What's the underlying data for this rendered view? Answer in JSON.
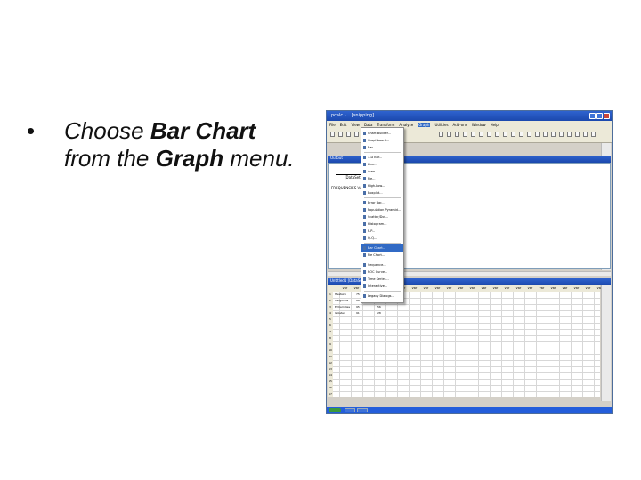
{
  "slide": {
    "bullet": "•",
    "line1_pre": "Choose ",
    "line1_bold": "Bar Chart",
    "line2_pre": "from the ",
    "line2_bold": "Graph",
    "line2_post": " menu."
  },
  "window": {
    "title": "pcalc - .. [snipping]",
    "menubar": [
      "File",
      "Edit",
      "View",
      "Data",
      "Transform",
      "Analyze",
      "Graph",
      "Utilities",
      "Add-ons",
      "Window",
      "Help"
    ],
    "active_menu": "Graph",
    "output_pane_title": "Output",
    "output_heading": "[DataSet1]",
    "output_text": "FREQUENCIES VARIABLES=pv",
    "data_pane_title": "Untitled1 [DataSet0] - SPSS Data Editor",
    "grid_columns": [
      "",
      "var",
      "var",
      "var",
      "var",
      "var",
      "var",
      "var",
      "var",
      "var",
      "var",
      "var",
      "var",
      "var",
      "var",
      "var",
      "var",
      "var",
      "var",
      "var",
      "var",
      "var",
      "var",
      "var"
    ],
    "grid_cells": [
      [
        "Heatsink",
        "75",
        "41"
      ],
      [
        "Invigorate",
        "86",
        "49"
      ],
      [
        "Extremities",
        "95",
        "56"
      ],
      [
        "Isolated",
        "91",
        "28"
      ]
    ]
  },
  "graph_menu": {
    "items": [
      {
        "label": "Chart Builder...",
        "selected": false
      },
      {
        "label": "Graphboard...",
        "selected": false
      },
      {
        "label": "Bar...",
        "selected": false
      },
      {
        "label": "3-D Bar...",
        "selected": false
      },
      {
        "label": "Line...",
        "selected": false
      },
      {
        "label": "Area...",
        "selected": false
      },
      {
        "label": "Pie...",
        "selected": false
      },
      {
        "label": "High-Low...",
        "selected": false
      },
      {
        "label": "Boxplot...",
        "selected": false
      },
      {
        "label": "Error Bar...",
        "selected": false
      },
      {
        "label": "Population Pyramid...",
        "selected": false
      },
      {
        "label": "Scatter/Dot...",
        "selected": false
      },
      {
        "label": "Histogram...",
        "selected": false
      },
      {
        "label": "P-P...",
        "selected": false
      },
      {
        "label": "Q-Q...",
        "selected": false
      },
      {
        "label": "Bar Chart...",
        "selected": true
      },
      {
        "label": "Pie Chart...",
        "selected": false
      },
      {
        "label": "Sequence...",
        "selected": false
      },
      {
        "label": "ROC Curve...",
        "selected": false
      },
      {
        "label": "Time Series...",
        "selected": false
      },
      {
        "label": "Interactive...",
        "selected": false
      },
      {
        "label": "Legacy Dialogs...",
        "selected": false
      }
    ]
  }
}
